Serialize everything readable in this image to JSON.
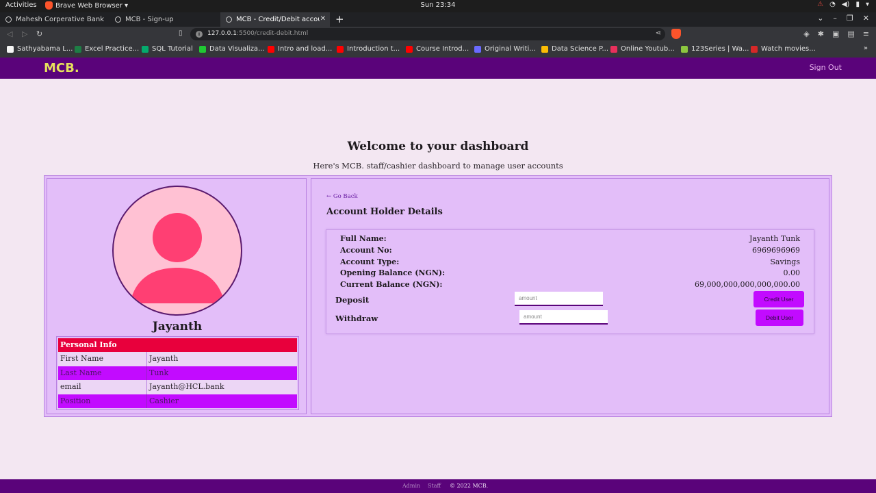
{
  "system_bar": {
    "activities": "Activities",
    "app_name": "Brave Web Browser ▾",
    "clock": "Sun 23:34"
  },
  "browser": {
    "tabs": [
      {
        "label": "Mahesh Corperative Bank"
      },
      {
        "label": "MCB - Sign-up"
      },
      {
        "label": "MCB - Credit/Debit accou"
      }
    ],
    "url_host": "127.0.0.1",
    "url_rest": ":5500/credit-debit.html",
    "bookmarks": [
      {
        "label": "Sathyabama L...",
        "color": "#f5f5f5"
      },
      {
        "label": "Excel Practice...",
        "color": "#1e7e45"
      },
      {
        "label": "SQL Tutorial",
        "color": "#04aa6d"
      },
      {
        "label": "Data Visualiza...",
        "color": "#20c933"
      },
      {
        "label": "Intro and load...",
        "color": "#ff0000"
      },
      {
        "label": "Introduction t...",
        "color": "#ff0000"
      },
      {
        "label": "Course Introd...",
        "color": "#ff0000"
      },
      {
        "label": "Original Writi...",
        "color": "#6a6aff"
      },
      {
        "label": "Data Science P...",
        "color": "#fbbc04"
      },
      {
        "label": "Online Youtub...",
        "color": "#e8305c"
      },
      {
        "label": "123Series | Wa...",
        "color": "#8cc63f"
      },
      {
        "label": "Watch movies...",
        "color": "#d62828"
      }
    ]
  },
  "header": {
    "logo": "MCB.",
    "sign_out": "Sign Out"
  },
  "welcome": {
    "title": "Welcome to your dashboard",
    "subtitle": "Here's MCB. staff/cashier dashboard to manage user accounts"
  },
  "profile": {
    "name": "Jayanth",
    "info_header": "Personal Info",
    "rows": [
      {
        "key": "First Name",
        "value": "Jayanth"
      },
      {
        "key": "Last Name",
        "value": "Tunk"
      },
      {
        "key": "email",
        "value": "Jayanth@HCL.bank"
      },
      {
        "key": "Position",
        "value": "Cashier"
      }
    ]
  },
  "account": {
    "go_back": "← Go Back",
    "title": "Account Holder Details",
    "details": [
      {
        "label": "Full Name:",
        "value": "Jayanth Tunk"
      },
      {
        "label": "Account No:",
        "value": "6969696969"
      },
      {
        "label": "Account Type:",
        "value": "Savings"
      },
      {
        "label": "Opening Balance (NGN):",
        "value": "0.00"
      },
      {
        "label": "Current Balance (NGN):",
        "value": "69,000,000,000,000,000.00"
      }
    ],
    "deposit_label": "Deposit",
    "withdraw_label": "Withdraw",
    "amount_placeholder": "amount",
    "credit_button": "Credit User",
    "debit_button": "Debit User"
  },
  "footer": {
    "admin": "Admin",
    "staff": "Staff",
    "copyright": "© 2022 MCB."
  }
}
